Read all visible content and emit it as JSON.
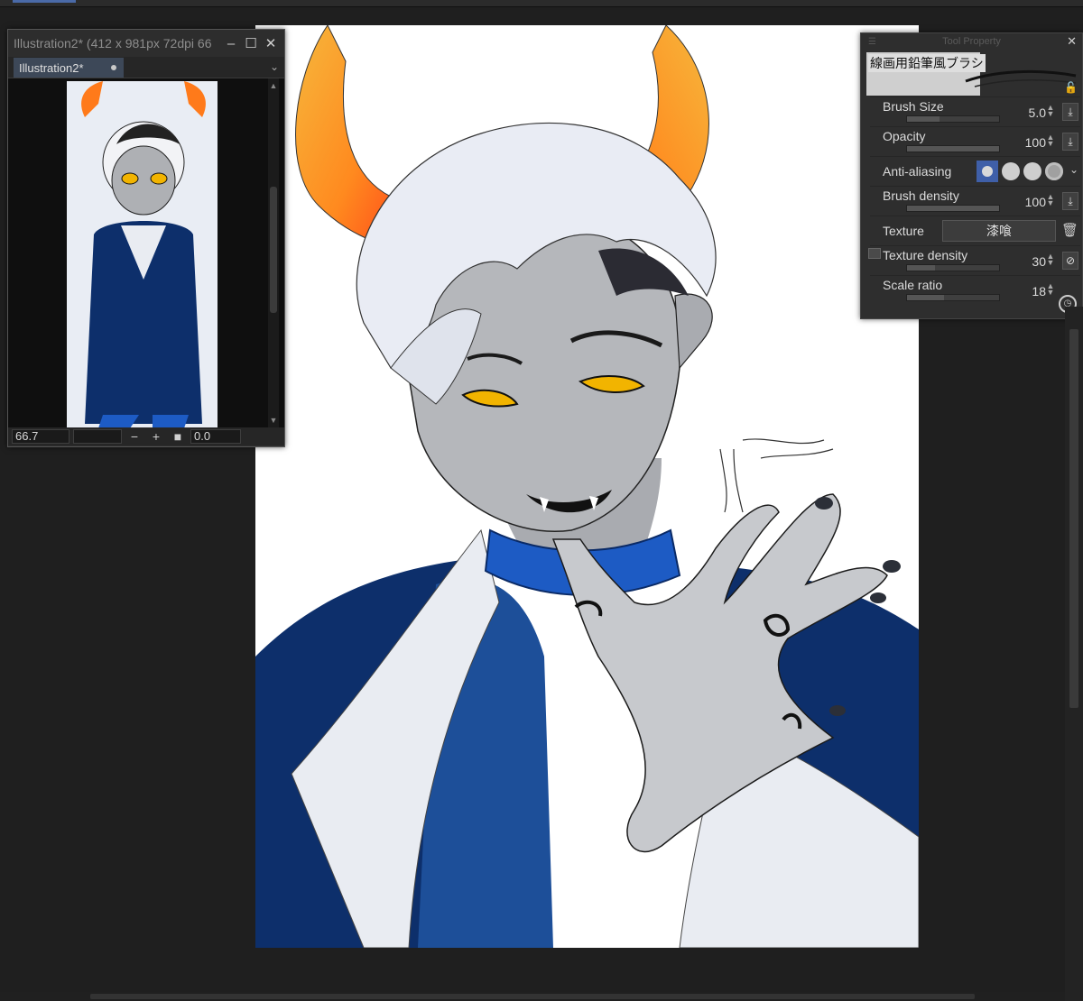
{
  "navigator": {
    "title": "Illustration2* (412 x 981px 72dpi 66",
    "tab_label": "Illustration2*",
    "zoom": "66.7",
    "rotation": "0.0",
    "icons": [
      "minimize-icon",
      "maximize-icon",
      "close-icon",
      "chevron-down-icon",
      "zoom-out-icon",
      "zoom-in-icon",
      "fit-icon"
    ]
  },
  "tool_property": {
    "title": "Tool Property",
    "brush_name": "線画用鉛筆風ブラシ",
    "rows": [
      {
        "label": "Brush Size",
        "value": "5.0",
        "fill": 0.35
      },
      {
        "label": "Opacity",
        "value": "100",
        "fill": 1.0
      },
      {
        "label": "Anti-aliasing",
        "value": ""
      },
      {
        "label": "Brush density",
        "value": "100",
        "fill": 1.0
      },
      {
        "label": "Texture",
        "value": "漆喰"
      },
      {
        "label": "Texture density",
        "value": "30",
        "fill": 0.3
      },
      {
        "label": "Scale ratio",
        "value": "18",
        "fill": 0.4
      }
    ]
  },
  "canvas": {
    "description_colors": {
      "horn_outer": "#f5a623",
      "horn_inner": "#ff5a1f",
      "suit_blue": "#0d2f6b",
      "shirt_blue": "#1d4f99",
      "skin_gray": "#a9abb0",
      "eye_yellow": "#f2b400"
    }
  }
}
